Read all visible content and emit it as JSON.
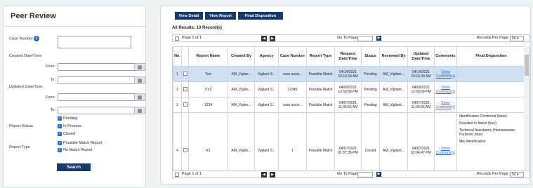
{
  "filter_panel": {
    "title": "Peer Review",
    "case_number_label": "Case Number",
    "created_label": "Created Date/Time",
    "updated_label": "Updated Date/Time",
    "from_label": "From:",
    "to_label": "To:",
    "report_status_label": "Report Status",
    "report_status_options": [
      "Pending",
      "In Process",
      "Closed"
    ],
    "report_type_label": "Report Type",
    "report_type_options": [
      "Possible Match Report",
      "No Match Report"
    ],
    "search_label": "Search"
  },
  "toolbar": {
    "view_detail": "View Detail",
    "view_report": "View Report",
    "final_disposition": "Final Disposition"
  },
  "results_label": "All Results: 10 Record(s)",
  "pager": {
    "page_text": "Page 1 of 1",
    "go_to_page": "Go To Page",
    "records_per_page": "Records Per Page",
    "per_page_value": "50",
    "prev": "◀",
    "next": "▶",
    "go": "▶"
  },
  "table": {
    "headers": [
      "No.",
      "",
      "Report Name",
      "Created By",
      "Agency",
      "Case Number",
      "Report Type",
      "Request Date/Time",
      "Status",
      "Reviewed By",
      "Updated Date/Time",
      "Comments",
      "Final Disposition"
    ],
    "rows": [
      {
        "no": "1",
        "name": "Test",
        "created_by": "AM_Viglan...",
        "agency": "Vigilant S...",
        "case": "case assis...",
        "type": "Possible Match",
        "request": "04/14/2021 10:16:34 AM",
        "status": "Pending",
        "reviewed_by": "AM_Vigilant...",
        "updated": "04/14/2021 10:16:34 AM",
        "comments": "Show Comment(s)",
        "final": ""
      },
      {
        "no": "2",
        "name": "XYZ",
        "created_by": "AM_Viglan...",
        "agency": "Vigilant S...",
        "case": "12345",
        "type": "Possible Match",
        "request": "04/09/2021 12:50:58 PM",
        "status": "Pending",
        "reviewed_by": "AM_Vigilant...",
        "updated": "04/09/2021 12:50:58 PM",
        "comments": "Show Comment(s)",
        "final": ""
      },
      {
        "no": "3",
        "name": "1234",
        "created_by": "AM_Viglan...",
        "agency": "Vigilant S...",
        "case": "case assis...",
        "type": "Possible Match",
        "request": "04/07/2021 11:05:55 AM",
        "status": "Pending",
        "reviewed_by": "AM_Vigilant...",
        "updated": "04/07/2021 11:05:55 AM",
        "comments": "Show Comment(s)",
        "final": ""
      },
      {
        "no": "4",
        "name": "R1",
        "created_by": "AM_Viglan...",
        "agency": "Vigilant S...",
        "case": "1",
        "type": "Possible Match",
        "request": "04/07/2021 01:57:35 PM",
        "status": "Closed",
        "reviewed_by": "AM_Vigilant...",
        "updated": "04/07/2021 02:04:47 PM",
        "comments": "Show Comment(s)",
        "final": [
          "Identification Confirmed (false)",
          "Resulted in Arrest (true)",
          "Technical Assistance (Humanitarian Purpose) (true)",
          "Mis-Identification"
        ]
      }
    ]
  },
  "icons": {
    "info": "info-icon",
    "calendar": "calendar-icon",
    "checkbox": "checkbox-checked-icon"
  },
  "colors": {
    "primary_button": "#163a6b",
    "selected_row": "#cfe0f6",
    "link": "#2a6bd1"
  }
}
